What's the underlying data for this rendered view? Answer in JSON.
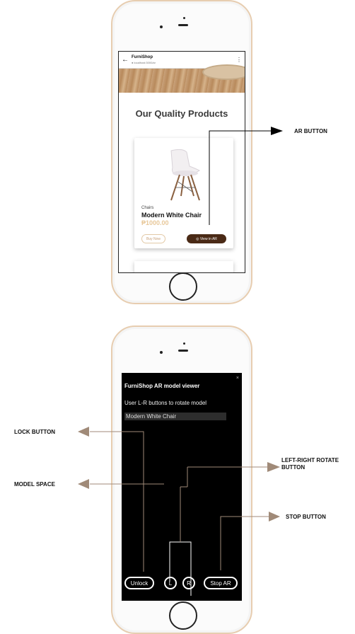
{
  "screen1": {
    "browser": {
      "back_icon": "back-arrow-icon",
      "site_name": "FurniShop",
      "site_url": "● localhost:3000/ar",
      "menu_icon": "kebab-menu-icon"
    },
    "section_title": "Our Quality Products",
    "product": {
      "category": "Chairs",
      "name": "Modern White Chair",
      "price": "₱1000.00",
      "buy_label": "Buy Now",
      "ar_label": "◎ View in AR"
    }
  },
  "screen2": {
    "title": "FurniShop AR model viewer",
    "close": "×",
    "hint": "User L-R buttons to rotate model",
    "model_name": "Modern White Chair",
    "buttons": {
      "unlock": "Unlock",
      "left": "L",
      "right": "R",
      "stop": "Stop AR"
    }
  },
  "annotations": {
    "ar_button": "AR BUTTON",
    "lock_button": "LOCK BUTTON",
    "model_space": "MODEL SPACE",
    "rotate_button_line1": "LEFT-RIGHT ROTATE",
    "rotate_button_line2": "BUTTON",
    "stop_button": "STOP BUTTON"
  },
  "colors": {
    "brand_brown": "#4a2a16",
    "price_gold": "#e8c89a",
    "annotation_arrow": "#a08a78",
    "phone_frame": "#e7cdb0"
  }
}
